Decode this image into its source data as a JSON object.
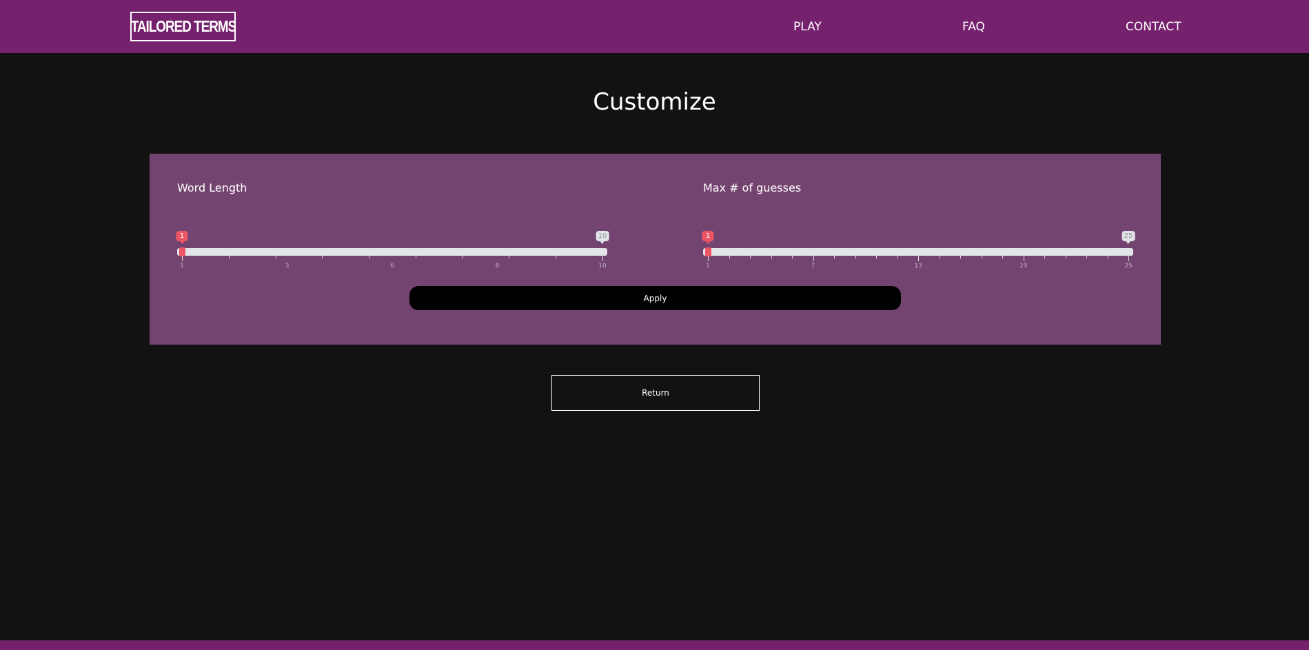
{
  "header": {
    "logo_text": "TAILORED TERMS",
    "nav": {
      "play": "PLAY",
      "faq": "FAQ",
      "contact": "CONTACT"
    }
  },
  "page": {
    "title": "Customize"
  },
  "settings": {
    "word_length": {
      "label": "Word Length",
      "min": 1,
      "max": 10,
      "from": 1,
      "to": 10,
      "from_label": "1",
      "to_label": "10",
      "tick_labels": [
        "1",
        "3",
        "6",
        "8",
        "10"
      ]
    },
    "max_guesses": {
      "label": "Max # of guesses",
      "min": 1,
      "max": 25,
      "from": 1,
      "to": 25,
      "from_label": "1",
      "to_label": "25",
      "tick_labels": [
        "1",
        "7",
        "13",
        "19",
        "25"
      ]
    },
    "apply_label": "Apply"
  },
  "actions": {
    "return_label": "Return"
  },
  "colors": {
    "brand": "#76216d",
    "panel": "#744470",
    "background": "#121212",
    "accent": "#ed5565"
  }
}
